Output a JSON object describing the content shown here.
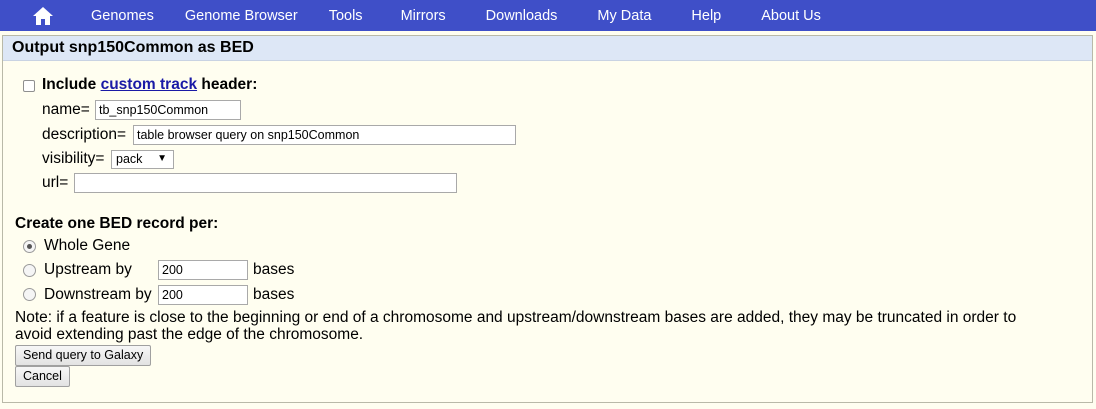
{
  "nav": {
    "home_icon": "home-icon",
    "items": [
      "Genomes",
      "Genome Browser",
      "Tools",
      "Mirrors",
      "Downloads",
      "My Data",
      "Help",
      "About Us"
    ]
  },
  "panel": {
    "title": "Output snp150Common as BED"
  },
  "header_opts": {
    "include_prefix": "Include ",
    "include_link": "custom track",
    "include_suffix": " header:",
    "name_label": "name=",
    "name_value": "tb_snp150Common",
    "description_label": "description=",
    "description_value": "table browser query on snp150Common",
    "visibility_label": "visibility=",
    "visibility_value": "pack",
    "url_label": "url=",
    "url_value": ""
  },
  "bed": {
    "heading": "Create one BED record per:",
    "whole_gene": "Whole Gene",
    "upstream_label": "Upstream by",
    "upstream_value": "200",
    "upstream_units": "bases",
    "downstream_label": "Downstream by",
    "downstream_value": "200",
    "downstream_units": "bases",
    "selected": "Whole Gene"
  },
  "note": {
    "line1": "Note: if a feature is close to the beginning or end of a chromosome and upstream/downstream bases are added, they may be truncated in order to",
    "line2": "avoid extending past the edge of the chromosome."
  },
  "buttons": {
    "send": "Send query to Galaxy",
    "cancel": "Cancel"
  },
  "colors": {
    "nav_bg": "#3f4fc8",
    "header_bg": "#dde7f6",
    "page_bg": "#fffef0",
    "link": "#1a1aa6"
  }
}
